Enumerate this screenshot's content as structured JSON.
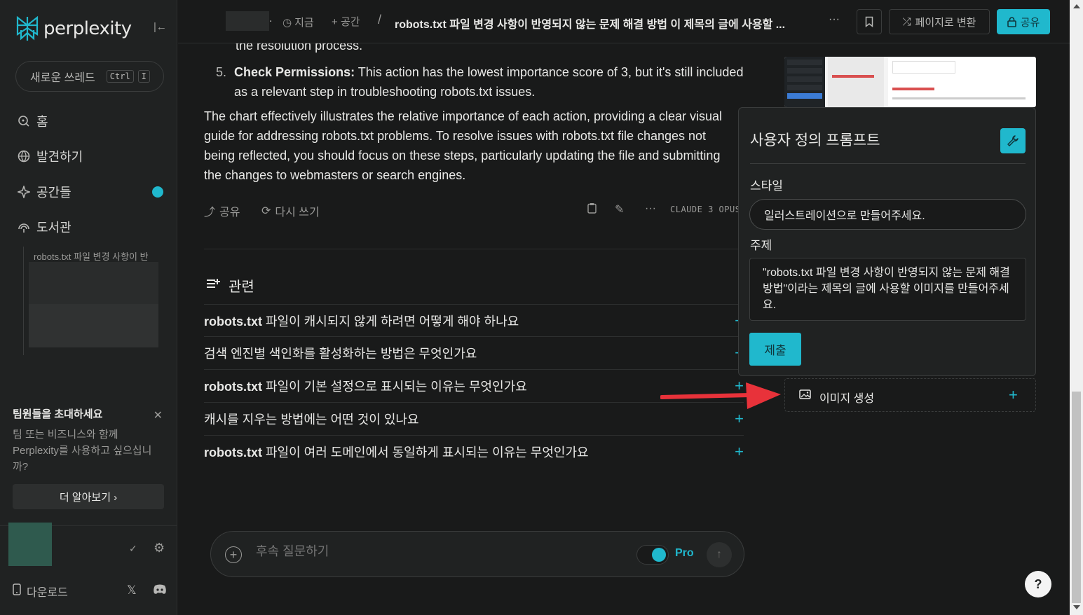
{
  "sidebar": {
    "logo_text": "perplexity",
    "new_thread_label": "새로운 쓰레드",
    "shortcut_keys": [
      "Ctrl",
      "I"
    ],
    "nav": [
      {
        "label": "홈",
        "icon": "search-icon"
      },
      {
        "label": "발견하기",
        "icon": "globe-icon"
      },
      {
        "label": "공간들",
        "icon": "sparkle-icon"
      },
      {
        "label": "도서관",
        "icon": "library-icon"
      }
    ],
    "library_entry": "robots.txt 파일 변경 사항이 반",
    "invite": {
      "title": "팀원들을 초대하세요",
      "body": "팀 또는 비즈니스와 함께 Perplexity를 사용하고 싶으십니까?",
      "button": "더 알아보기 ›"
    },
    "download_label": "다운로드"
  },
  "topbar": {
    "time_label": "지금",
    "space_label": "공간",
    "title": "robots.txt 파일 변경 사항이 반영되지 않는 문제 해결 방법 이 제목의 글에 사용할 ...",
    "convert_label": "페이지로 변환",
    "share_label": "공유"
  },
  "answer": {
    "cut_line": "the resolution process.",
    "item5_num": "5.",
    "item5_bold": "Check Permissions:",
    "item5_text": " This action has the lowest importance score of 3, but it's still included as a relevant step in troubleshooting robots.txt issues.",
    "paragraph": "The chart effectively illustrates the relative importance of each action, providing a clear visual guide for addressing robots.txt problems. To resolve issues with robots.txt file changes not being reflected, you should focus on these steps, particularly updating the file and submitting the changes to webmasters or search engines.",
    "share_label": "공유",
    "rewrite_label": "다시 쓰기",
    "model_label": "CLAUDE 3 OPUS"
  },
  "related": {
    "heading": "관련",
    "items": [
      {
        "bold": "robots.txt",
        "text": " 파일이 캐시되지 않게 하려면 어떻게 해야 하나요"
      },
      {
        "bold": "",
        "text": "검색 엔진별 색인화를 활성화하는 방법은 무엇인가요"
      },
      {
        "bold": "robots.txt",
        "text": " 파일이 기본 설정으로 표시되는 이유는 무엇인가요"
      },
      {
        "bold": "",
        "text": "캐시를 지우는 방법에는 어떤 것이 있나요"
      },
      {
        "bold": "robots.txt",
        "text": " 파일이 여러 도메인에서 동일하게 표시되는 이유는 무엇인가요"
      }
    ]
  },
  "followup": {
    "placeholder": "후속 질문하기",
    "pro_label": "Pro"
  },
  "prompt_panel": {
    "title": "사용자 정의 프롬프트",
    "style_label": "스타일",
    "style_value": "일러스트레이션으로 만들어주세요.",
    "topic_label": "주제",
    "topic_value": "\"robots.txt 파일 변경 사항이 반영되지 않는 문제 해결 방법\"이라는 제목의 글에 사용할 이미지를 만들어주세요.",
    "submit_label": "제출"
  },
  "image_gen": {
    "label": "이미지 생성"
  },
  "colors": {
    "accent": "#20b8cd",
    "background": "#191a1a",
    "sidebar": "#202222",
    "arrow": "#e8323a"
  }
}
